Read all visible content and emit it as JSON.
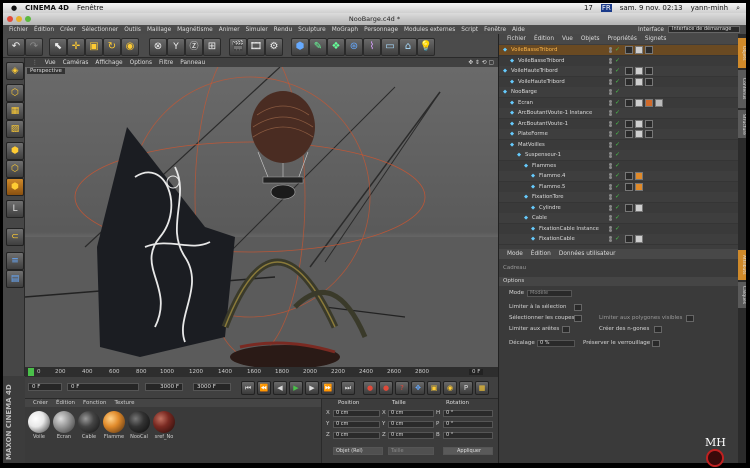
{
  "mac_menu": {
    "app": "CINEMA 4D",
    "window_menu": "Fenêtre",
    "status_17": "17",
    "flag": "FR",
    "clock": "sam. 9 nov. 02:13",
    "user": "yann-minh"
  },
  "window": {
    "title": "NooBarge.c4d *"
  },
  "app_menu": {
    "items": [
      "Fichier",
      "Édition",
      "Créer",
      "Sélectionner",
      "Outils",
      "Maillage",
      "Magnétisme",
      "Animer",
      "Simuler",
      "Rendu",
      "Sculpture",
      "MoGraph",
      "Personnage",
      "Modules externes",
      "Script",
      "Fenêtre",
      "Aide"
    ],
    "interface_label": "Interface",
    "layout_value": "Interface de démarrage"
  },
  "viewport": {
    "menu": [
      "Vue",
      "Caméras",
      "Affichage",
      "Options",
      "Filtre",
      "Panneau"
    ],
    "label": "Perspective"
  },
  "timeline": {
    "ticks": [
      "0",
      "200",
      "400",
      "600",
      "800",
      "1000",
      "1200",
      "1400",
      "1600",
      "1800",
      "2000",
      "2200",
      "2400",
      "2600",
      "2800"
    ],
    "end_frame": "0 F"
  },
  "frames": {
    "current": "0 F",
    "min": "0 F",
    "preview_max": "3000 F",
    "max": "3000 F"
  },
  "materials": {
    "menu": [
      "Créer",
      "Édition",
      "Fonction",
      "Texture"
    ],
    "items": [
      {
        "name": "Voile",
        "color": "#e8e8e8"
      },
      {
        "name": "Ecran",
        "color": "#9a9a9a"
      },
      {
        "name": "Cable",
        "color": "#444444"
      },
      {
        "name": "Flamme",
        "color": "#e08a2a"
      },
      {
        "name": "NooCal",
        "color": "#333333"
      },
      {
        "name": "sref_No",
        "color": "#7a2a22"
      }
    ],
    "brand": "MAXON CINEMA 4D"
  },
  "coords": {
    "headers": [
      "Position",
      "Taille",
      "Rotation"
    ],
    "axes": [
      "X",
      "Y",
      "Z"
    ],
    "rot_axes": [
      "H",
      "P",
      "B"
    ],
    "value": "0 cm",
    "rot_value": "0 °",
    "mode": "Objet (Rel)",
    "size_mode": "Taille",
    "apply": "Appliquer"
  },
  "object_manager": {
    "menu": [
      "Fichier",
      "Édition",
      "Vue",
      "Objets",
      "Propriétés",
      "Signets"
    ],
    "rows": [
      {
        "name": "VoileBasseTribord",
        "indent": 0,
        "selected": true,
        "tags": [
          "#2a2a2a",
          "#cfcfcf",
          "#2a2a2a"
        ]
      },
      {
        "name": "VoileBasseTribord",
        "indent": 1,
        "selected": false,
        "tags": []
      },
      {
        "name": "VoileHauteTribord",
        "indent": 0,
        "selected": false,
        "tags": [
          "#2a2a2a",
          "#cfcfcf",
          "#2a2a2a"
        ]
      },
      {
        "name": "VoileHauteTribord",
        "indent": 1,
        "selected": false,
        "tags": [
          "#2a2a2a",
          "#cfcfcf",
          "#2a2a2a"
        ]
      },
      {
        "name": "NooBarge",
        "indent": 0,
        "selected": false,
        "tags": []
      },
      {
        "name": "Ecran",
        "indent": 1,
        "selected": false,
        "tags": [
          "#2a2a2a",
          "#cfcfcf",
          "#d06a2a",
          "#bbbbbb"
        ]
      },
      {
        "name": "ArcBoutantVoute-1 Instance",
        "indent": 1,
        "selected": false,
        "tags": []
      },
      {
        "name": "ArcBoutantVoute-1",
        "indent": 1,
        "selected": false,
        "tags": [
          "#2a2a2a",
          "#cfcfcf",
          "#2a2a2a"
        ]
      },
      {
        "name": "PlateForme",
        "indent": 1,
        "selected": false,
        "tags": [
          "#2a2a2a",
          "#cfcfcf",
          "#2a2a2a"
        ]
      },
      {
        "name": "MatVoilles",
        "indent": 1,
        "selected": false,
        "tags": []
      },
      {
        "name": "Suspenseur-1",
        "indent": 2,
        "selected": false,
        "tags": []
      },
      {
        "name": "Flammes",
        "indent": 3,
        "selected": false,
        "tags": []
      },
      {
        "name": "Flamme.4",
        "indent": 4,
        "selected": false,
        "tags": [
          "#2a2a2a",
          "#e08a2a"
        ]
      },
      {
        "name": "Flamme.5",
        "indent": 4,
        "selected": false,
        "tags": [
          "#2a2a2a",
          "#e08a2a"
        ]
      },
      {
        "name": "FixationTore",
        "indent": 3,
        "selected": false,
        "tags": []
      },
      {
        "name": "Cylindre",
        "indent": 4,
        "selected": false,
        "tags": [
          "#2a2a2a",
          "#cfcfcf"
        ]
      },
      {
        "name": "Cable",
        "indent": 3,
        "selected": false,
        "tags": []
      },
      {
        "name": "FixationCable Instance",
        "indent": 4,
        "selected": false,
        "tags": []
      },
      {
        "name": "FixationCable",
        "indent": 4,
        "selected": false,
        "tags": [
          "#2a2a2a",
          "#cfcfcf"
        ]
      }
    ]
  },
  "attributes": {
    "menu": [
      "Mode",
      "Édition",
      "Données utilisateur"
    ],
    "object": "Cadreau",
    "section": "Options",
    "mode_label": "Mode",
    "mode_value": "Modèle",
    "limit_selection": "Limiter à la sélection",
    "select_loops": "Sélectionner les coupes",
    "limit_edges": "Limiter aux arêtes",
    "limit_visible": "Limiter aux polygones visibles",
    "create_ngons": "Créer des n-gones",
    "offset_label": "Décalage",
    "offset_value": "0 %",
    "keep_lock": "Préserver le verrouillage"
  },
  "side_tabs": [
    "Objets",
    "Contenus",
    "Structure",
    "Attributs",
    "Calques"
  ],
  "watermark": "MH"
}
